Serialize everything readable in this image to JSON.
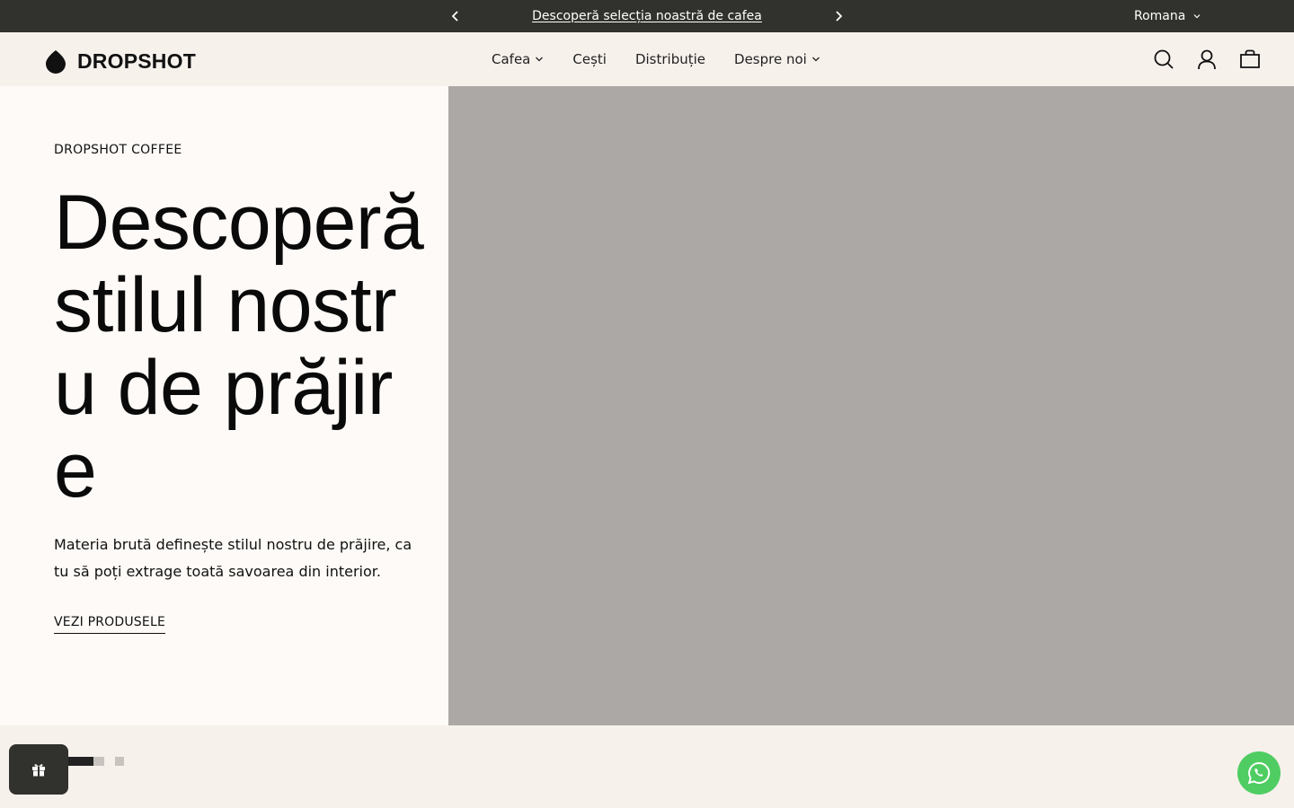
{
  "announcement": {
    "message": "Descoperă selecția noastră de cafea",
    "prev_icon": "chevron-left-icon",
    "next_icon": "chevron-right-icon",
    "language": "Romana"
  },
  "header": {
    "logo_text": "DROPSHOT",
    "nav": [
      {
        "label": "Cafea",
        "has_dropdown": true
      },
      {
        "label": "Cești",
        "has_dropdown": false
      },
      {
        "label": "Distribuție",
        "has_dropdown": false
      },
      {
        "label": "Despre noi",
        "has_dropdown": true
      }
    ],
    "icons": [
      "search-icon",
      "account-icon",
      "cart-icon"
    ]
  },
  "hero": {
    "eyebrow": "DROPSHOT COFFEE",
    "headline": "Descoperă stilul nostru de prăjire",
    "description": "Materia brută definește stilul nostru de prăjire, ca tu să poți extrage toată savoarea din interior.",
    "cta": "VEZI PRODUSELE",
    "image_placeholder_color": "#aca8a5"
  },
  "slider": {
    "slide_count": 3,
    "active_index": 0
  },
  "colors": {
    "announcement_bg": "#31312d",
    "header_bg": "#f7f1ec",
    "hero_text_bg": "#fdfaf7",
    "whatsapp": "#4fcd62"
  }
}
